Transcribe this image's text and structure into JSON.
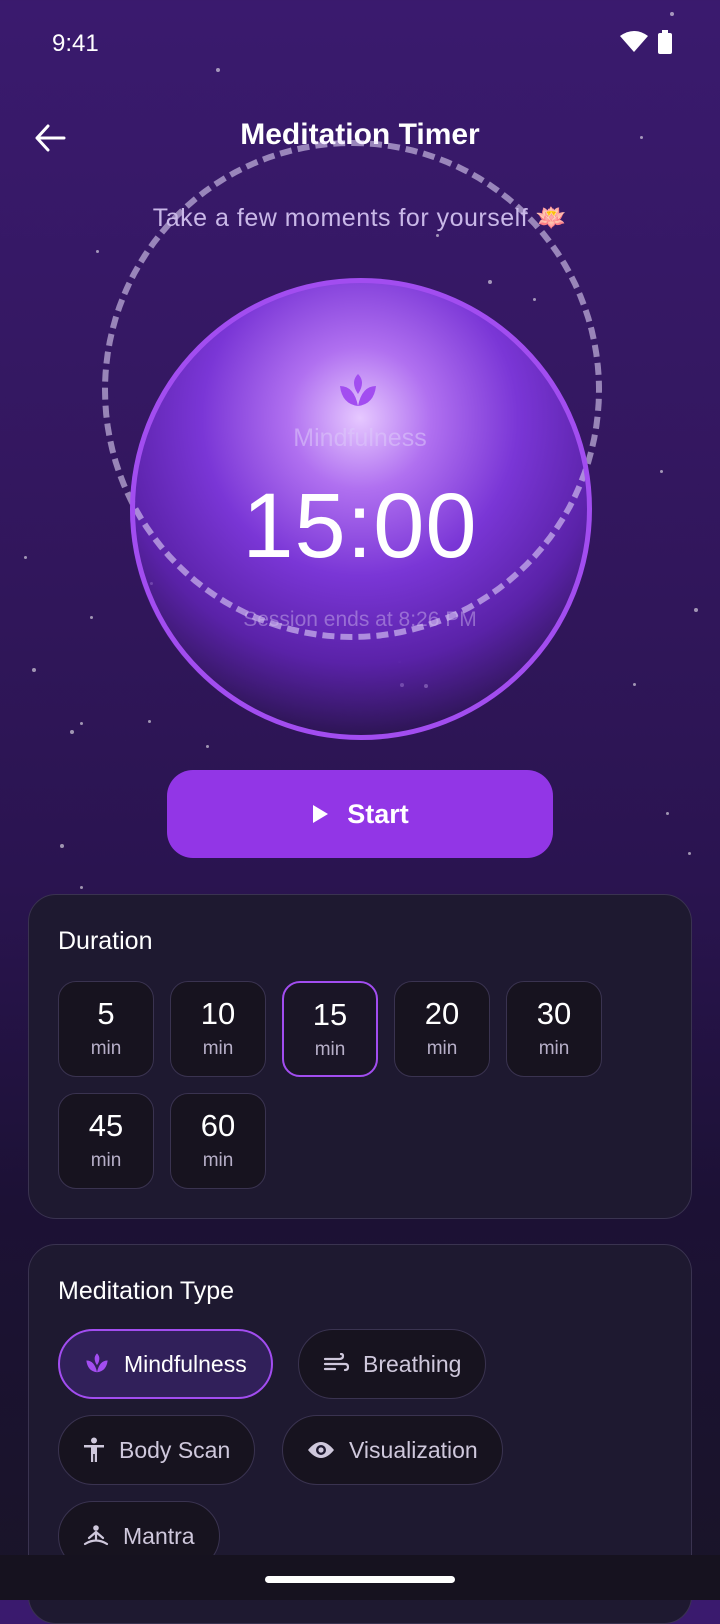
{
  "status_bar": {
    "time": "9:41"
  },
  "header": {
    "title": "Meditation Timer"
  },
  "subtitle": "Take a few moments for yourself 🪷",
  "timer": {
    "type_label": "Mindfulness",
    "time_display": "15:00",
    "session_end": "Session ends at 8:26 PM"
  },
  "start_button": {
    "label": "Start"
  },
  "duration": {
    "title": "Duration",
    "selected": "15",
    "options": [
      {
        "value": "5",
        "unit": "min"
      },
      {
        "value": "10",
        "unit": "min"
      },
      {
        "value": "15",
        "unit": "min"
      },
      {
        "value": "20",
        "unit": "min"
      },
      {
        "value": "30",
        "unit": "min"
      },
      {
        "value": "45",
        "unit": "min"
      },
      {
        "value": "60",
        "unit": "min"
      }
    ]
  },
  "meditation_type": {
    "title": "Meditation Type",
    "selected": "Mindfulness",
    "options": [
      {
        "label": "Mindfulness",
        "icon": "lotus-icon"
      },
      {
        "label": "Breathing",
        "icon": "wind-icon"
      },
      {
        "label": "Body Scan",
        "icon": "person-icon"
      },
      {
        "label": "Visualization",
        "icon": "eye-icon"
      },
      {
        "label": "Mantra",
        "icon": "meditation-pose-icon"
      }
    ]
  },
  "colors": {
    "accent": "#9236e6",
    "ring": "#a24df0",
    "card_bg": "#1e1930"
  }
}
